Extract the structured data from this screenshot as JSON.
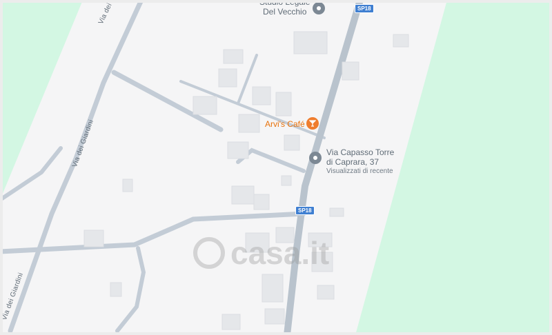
{
  "map": {
    "colors": {
      "land": "#f5f5f6",
      "green": "#d3f7e3",
      "road": "#c3ccd6",
      "building": "#e5e7ea"
    }
  },
  "pois": {
    "studio": {
      "line1": "Studio Legale",
      "line2": "Del Vecchio",
      "icon": "map-pin-icon"
    },
    "cafe": {
      "name": "Arvi's Café",
      "icon": "cocktail-icon"
    },
    "address": {
      "line1": "Via Capasso Torre",
      "line2": "di Caprara, 37",
      "sublabel": "Visualizzati di recente",
      "icon": "map-pin-icon"
    }
  },
  "streets": {
    "giardini_top": "Via dei Giardini",
    "giardini_mid": "Via dei Giardini",
    "giardini_bottom": "Via dei Giardini"
  },
  "shields": {
    "top": "SP18",
    "mid": "SP18"
  },
  "watermark": {
    "text": "casa.it"
  }
}
